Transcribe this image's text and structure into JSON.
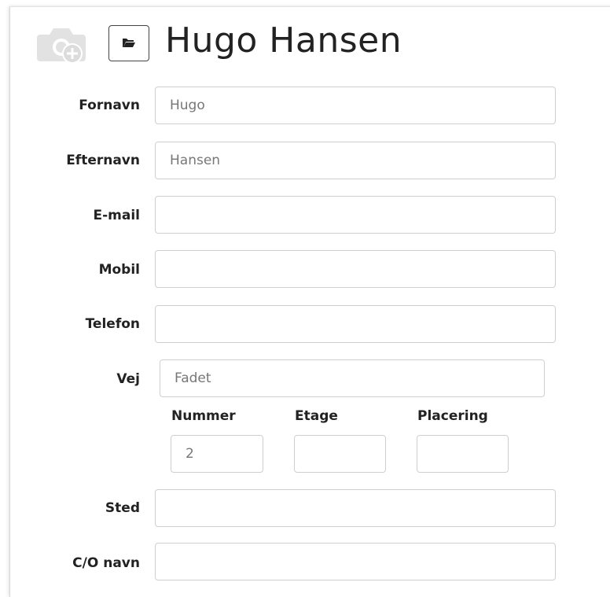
{
  "header": {
    "title": "Hugo Hansen",
    "photo_icon": "camera-add-icon",
    "folder_icon": "folder-open-icon"
  },
  "form": {
    "fornavn_label": "Fornavn",
    "fornavn_value": "Hugo",
    "efternavn_label": "Efternavn",
    "efternavn_value": "Hansen",
    "email_label": "E-mail",
    "email_value": "",
    "mobil_label": "Mobil",
    "mobil_value": "",
    "telefon_label": "Telefon",
    "telefon_value": "",
    "vej_label": "Vej",
    "vej_value": "Fadet",
    "nummer_label": "Nummer",
    "nummer_value": "2",
    "etage_label": "Etage",
    "etage_value": "",
    "placering_label": "Placering",
    "placering_value": "",
    "sted_label": "Sted",
    "sted_value": "",
    "co_label": "C/O navn",
    "co_value": ""
  }
}
